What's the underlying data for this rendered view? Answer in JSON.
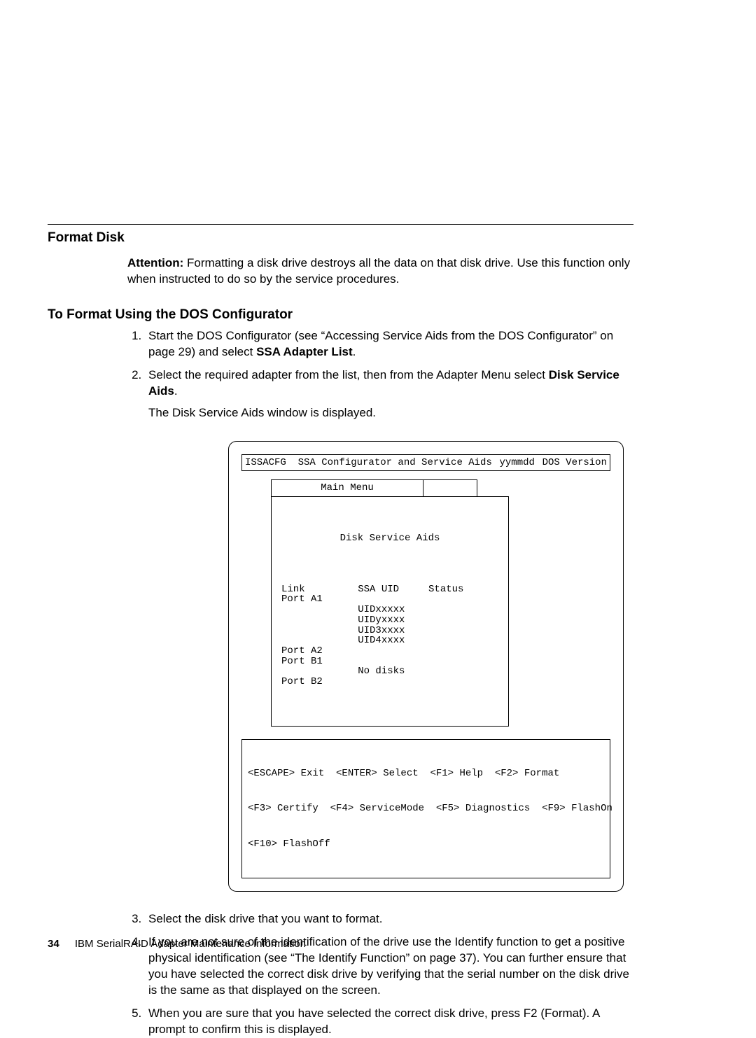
{
  "heading1": "Format Disk",
  "attention_label": "Attention:",
  "attention_text": "Formatting a disk drive destroys all the data on that disk drive. Use this function only when instructed to do so by the service procedures.",
  "heading2": "To Format Using the DOS Configurator",
  "step1a": "Start the DOS Configurator (see “Accessing Service Aids from the DOS Configurator” on page 29) and select ",
  "step1b": "SSA Adapter List",
  "step1c": ".",
  "step2a": "Select the required adapter from the list, then from the Adapter Menu select ",
  "step2b": "Disk Service Aids",
  "step2c": ".",
  "step2d": "The Disk Service Aids window is displayed.",
  "step3": "Select the disk drive that you want to format.",
  "step4": "If you are not sure of the identification of the drive use the Identify function to get a positive physical identification (see “The Identify Function” on page 37). You can further ensure that you have selected the correct disk drive by verifying that the serial number on the disk drive is the same as that displayed on the screen.",
  "step5": "When you are sure that you have selected the correct disk drive, press F2 (Format).  A prompt to confirm this is displayed.",
  "figure": {
    "top_left": "ISSACFG  SSA Configurator and Service Aids",
    "top_mid": "yymmdd",
    "top_right": "DOS Version",
    "menu_tab": "Main Menu",
    "blank_tab": " ",
    "panel_title": "Disk Service Aids",
    "panel_body": "Link         SSA UID     Status\nPort A1\n             UIDxxxxx\n             UIDyxxxx\n             UID3xxxx\n             UID4xxxx\nPort A2\nPort B1\n             No disks\nPort B2",
    "keys_line1": "<ESCAPE> Exit  <ENTER> Select  <F1> Help  <F2> Format",
    "keys_line2": "<F3> Certify  <F4> ServiceMode  <F5> Diagnostics  <F9> FlashOn",
    "keys_line3": "<F10> FlashOff"
  },
  "footer_page": "34",
  "footer_title": "IBM SerialRAID Adapter Maintenance Information"
}
